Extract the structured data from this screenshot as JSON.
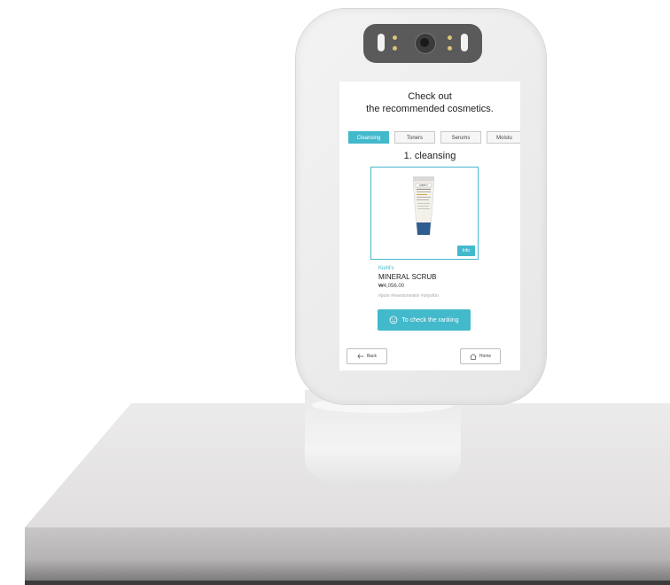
{
  "screen": {
    "title_line1": "Check out",
    "title_line2": "the recommended cosmetics.",
    "tabs": [
      {
        "label": "Cleansing",
        "active": true
      },
      {
        "label": "Toners",
        "active": false
      },
      {
        "label": "Serums",
        "active": false
      },
      {
        "label": "Moistu",
        "active": false
      }
    ],
    "section_heading": "1. cleansing",
    "product": {
      "image_label": "KIEHL'S",
      "info_label": "Info",
      "brand": "Kiehl's",
      "name": "MINERAL SCRUB",
      "price": "₩4,056.00",
      "tags": "#pore #eventoneskin #oilysKin"
    },
    "ranking_button": "To check the ranking",
    "back_button": "Back",
    "home_button": "Home"
  },
  "colors": {
    "accent": "#43b9cc",
    "device_body": "#eeeeee",
    "camera_bar": "#5a5a5a",
    "marble": "#e3e1e1"
  },
  "icons": [
    "smile-icon",
    "arrow-left-icon",
    "home-icon"
  ]
}
